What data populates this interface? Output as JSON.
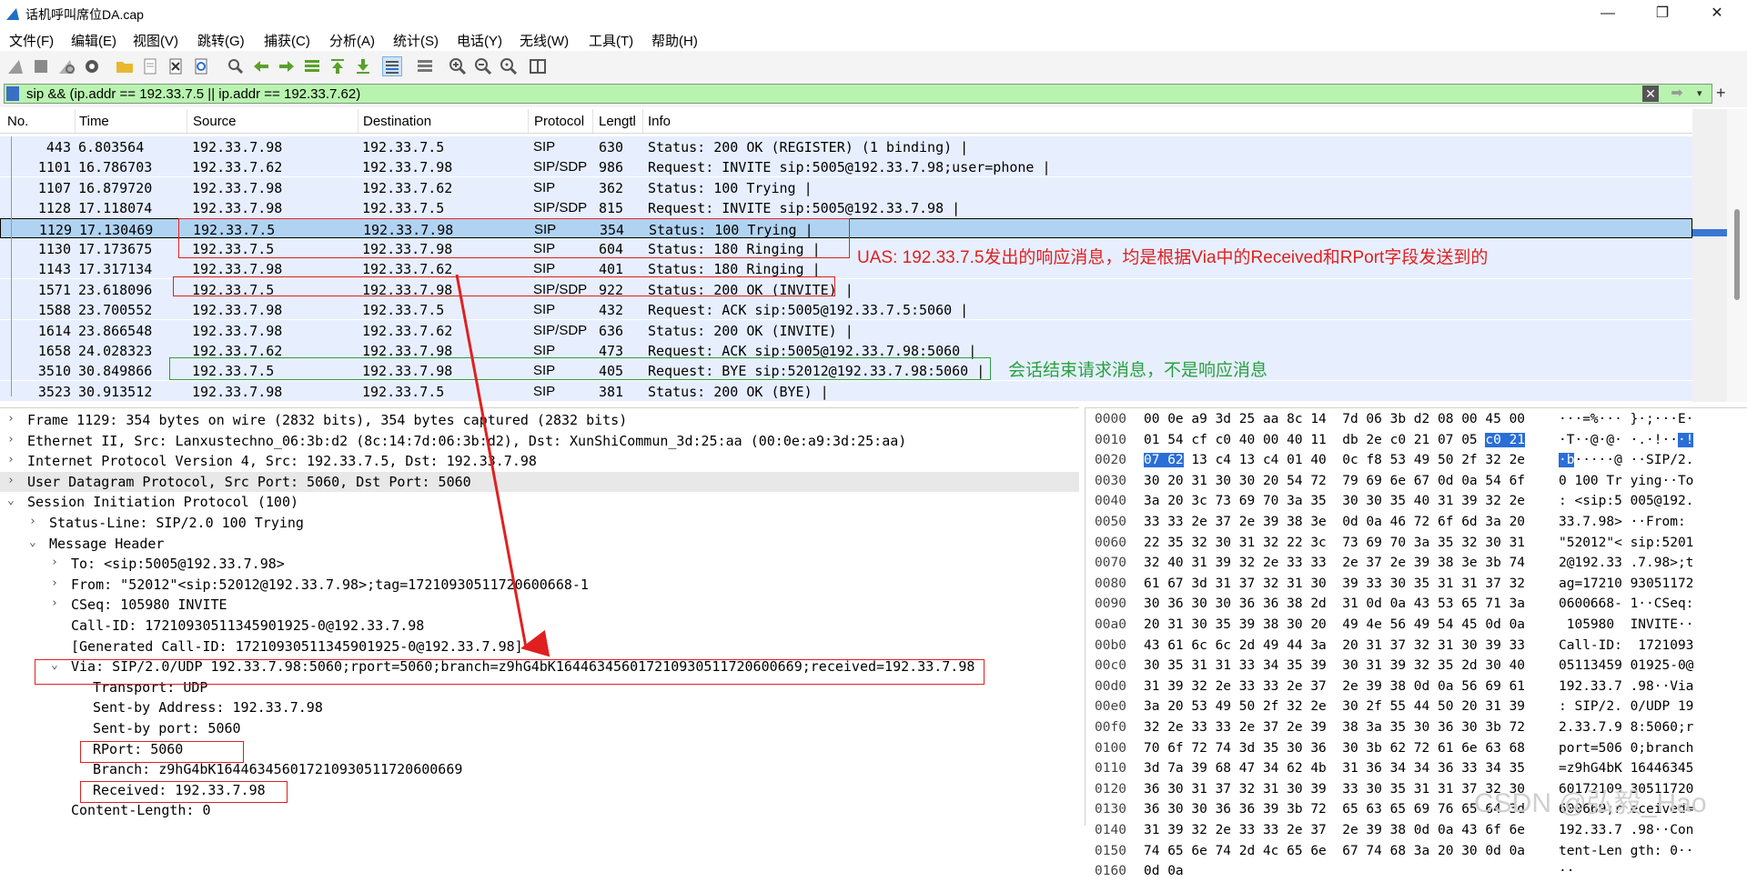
{
  "window": {
    "title": "话机呼叫席位DA.cap",
    "minimize": "—",
    "maximize": "❐",
    "close": "✕"
  },
  "menu": [
    "文件(F)",
    "编辑(E)",
    "视图(V)",
    "跳转(G)",
    "捕获(C)",
    "分析(A)",
    "统计(S)",
    "电话(Y)",
    "无线(W)",
    "工具(T)",
    "帮助(H)"
  ],
  "toolbar": {
    "icons": [
      "shark-fin-start-icon",
      "stop-icon",
      "restart-icon",
      "options-gear-icon",
      "open-folder-icon",
      "file-icon",
      "close-file-icon",
      "reload-icon",
      "find-icon",
      "back-icon",
      "forward-icon",
      "goto-packet-icon",
      "first-packet-icon",
      "last-packet-icon",
      "autoscroll-icon",
      "colorize-icon",
      "zoom-in-icon",
      "zoom-out-icon",
      "zoom-normal-icon",
      "resize-columns-icon"
    ]
  },
  "filter": {
    "text": "sip &&  (ip.addr == 192.33.7.5 || ip.addr == 192.33.7.62)",
    "clear": "✕",
    "apply": "➡",
    "dropdown": "▾",
    "add": "+"
  },
  "packet_list": {
    "columns": [
      "No.",
      "Time",
      "Source",
      "Destination",
      "Protocol",
      "Lengtl",
      "Info"
    ],
    "rows": [
      {
        "no": "443",
        "time": "6.803564",
        "src": "192.33.7.98",
        "dst": "192.33.7.5",
        "proto": "SIP",
        "len": "630",
        "info": "Status: 200 OK (REGISTER)  (1 binding) |"
      },
      {
        "no": "1101",
        "time": "16.786703",
        "src": "192.33.7.62",
        "dst": "192.33.7.98",
        "proto": "SIP/SDP",
        "len": "986",
        "info": "Request: INVITE sip:5005@192.33.7.98;user=phone |"
      },
      {
        "no": "1107",
        "time": "16.879720",
        "src": "192.33.7.98",
        "dst": "192.33.7.62",
        "proto": "SIP",
        "len": "362",
        "info": "Status: 100 Trying |"
      },
      {
        "no": "1128",
        "time": "17.118074",
        "src": "192.33.7.98",
        "dst": "192.33.7.5",
        "proto": "SIP/SDP",
        "len": "815",
        "info": "Request: INVITE sip:5005@192.33.7.98 |"
      },
      {
        "no": "1129",
        "time": "17.130469",
        "src": "192.33.7.5",
        "dst": "192.33.7.98",
        "proto": "SIP",
        "len": "354",
        "info": "Status: 100 Trying |"
      },
      {
        "no": "1130",
        "time": "17.173675",
        "src": "192.33.7.5",
        "dst": "192.33.7.98",
        "proto": "SIP",
        "len": "604",
        "info": "Status: 180 Ringing |"
      },
      {
        "no": "1143",
        "time": "17.317134",
        "src": "192.33.7.98",
        "dst": "192.33.7.62",
        "proto": "SIP",
        "len": "401",
        "info": "Status: 180 Ringing |"
      },
      {
        "no": "1571",
        "time": "23.618096",
        "src": "192.33.7.5",
        "dst": "192.33.7.98",
        "proto": "SIP/SDP",
        "len": "922",
        "info": "Status: 200 OK (INVITE) |"
      },
      {
        "no": "1588",
        "time": "23.700552",
        "src": "192.33.7.98",
        "dst": "192.33.7.5",
        "proto": "SIP",
        "len": "432",
        "info": "Request: ACK sip:5005@192.33.7.5:5060 |"
      },
      {
        "no": "1614",
        "time": "23.866548",
        "src": "192.33.7.98",
        "dst": "192.33.7.62",
        "proto": "SIP/SDP",
        "len": "636",
        "info": "Status: 200 OK (INVITE) |"
      },
      {
        "no": "1658",
        "time": "24.028323",
        "src": "192.33.7.62",
        "dst": "192.33.7.98",
        "proto": "SIP",
        "len": "473",
        "info": "Request: ACK sip:5005@192.33.7.98:5060 |"
      },
      {
        "no": "3510",
        "time": "30.849866",
        "src": "192.33.7.5",
        "dst": "192.33.7.98",
        "proto": "SIP",
        "len": "405",
        "info": "Request: BYE sip:52012@192.33.7.98:5060 |"
      },
      {
        "no": "3523",
        "time": "30.913512",
        "src": "192.33.7.98",
        "dst": "192.33.7.5",
        "proto": "SIP",
        "len": "381",
        "info": "Status: 200 OK (BYE) |"
      }
    ],
    "selected_no": "1129"
  },
  "details": [
    {
      "text": "Frame 1129: 354 bytes on wire (2832 bits), 354 bytes captured (2832 bits)",
      "arrow": "›",
      "indent": 0
    },
    {
      "text": "Ethernet II, Src: Lanxustechno_06:3b:d2 (8c:14:7d:06:3b:d2), Dst: XunShiCommun_3d:25:aa (00:0e:a9:3d:25:aa)",
      "arrow": "›",
      "indent": 0
    },
    {
      "text": "Internet Protocol Version 4, Src: 192.33.7.5, Dst: 192.33.7.98",
      "arrow": "›",
      "indent": 0
    },
    {
      "text": "User Datagram Protocol, Src Port: 5060, Dst Port: 5060",
      "arrow": "›",
      "indent": 0,
      "shade": true
    },
    {
      "text": "Session Initiation Protocol (100)",
      "arrow": "⌄",
      "indent": 0
    },
    {
      "text": "Status-Line: SIP/2.0 100 Trying",
      "arrow": "›",
      "indent": 1
    },
    {
      "text": "Message Header",
      "arrow": "⌄",
      "indent": 1
    },
    {
      "text": "To: <sip:5005@192.33.7.98>",
      "arrow": "›",
      "indent": 2
    },
    {
      "text": "From: \"52012\"<sip:52012@192.33.7.98>;tag=17210930511720600668-1",
      "arrow": "›",
      "indent": 2
    },
    {
      "text": "CSeq: 105980 INVITE",
      "arrow": "›",
      "indent": 2
    },
    {
      "text": "Call-ID: 17210930511345901925-0@192.33.7.98",
      "arrow": "",
      "indent": 2
    },
    {
      "text": "[Generated Call-ID: 17210930511345901925-0@192.33.7.98]",
      "arrow": "",
      "indent": 2
    },
    {
      "text": "Via: SIP/2.0/UDP 192.33.7.98:5060;rport=5060;branch=z9hG4bK16446345601721093051172060066​9;received=192.33.7.98",
      "arrow": "⌄",
      "indent": 2
    },
    {
      "text": "Transport: UDP",
      "arrow": "",
      "indent": 3
    },
    {
      "text": "Sent-by Address: 192.33.7.98",
      "arrow": "",
      "indent": 3
    },
    {
      "text": "Sent-by port: 5060",
      "arrow": "",
      "indent": 3
    },
    {
      "text": "RPort: 5060",
      "arrow": "",
      "indent": 3
    },
    {
      "text": "Branch: z9hG4bK16446345601721093051172060066​9",
      "arrow": "",
      "indent": 3
    },
    {
      "text": "Received: 192.33.7.98",
      "arrow": "",
      "indent": 3
    },
    {
      "text": "Content-Length: 0",
      "arrow": "",
      "indent": 2
    }
  ],
  "bytes": [
    {
      "off": "0000",
      "hex": "00 0e a9 3d 25 aa 8c 14  7d 06 3b d2 08 00 45 00",
      "asc": "···=%··· }·;···E·"
    },
    {
      "off": "0010",
      "hex": "01 54 cf c0 40 00 40 11  db 2e c0 21 07 05 c0 21",
      "asc": "·T··@·@· ·.·!···!"
    },
    {
      "off": "0020",
      "hex": "07 62 13 c4 13 c4 01 40  0c f8 53 49 50 2f 32 2e",
      "asc": "·b·····@ ··SIP/2."
    },
    {
      "off": "0030",
      "hex": "30 20 31 30 30 20 54 72  79 69 6e 67 0d 0a 54 6f",
      "asc": "0 100 Tr ying··To"
    },
    {
      "off": "0040",
      "hex": "3a 20 3c 73 69 70 3a 35  30 30 35 40 31 39 32 2e",
      "asc": ": <sip:5 005@192."
    },
    {
      "off": "0050",
      "hex": "33 33 2e 37 2e 39 38 3e  0d 0a 46 72 6f 6d 3a 20",
      "asc": "33.7.98> ··From: "
    },
    {
      "off": "0060",
      "hex": "22 35 32 30 31 32 22 3c  73 69 70 3a 35 32 30 31",
      "asc": "\"52012\"< sip:5201"
    },
    {
      "off": "0070",
      "hex": "32 40 31 39 32 2e 33 33  2e 37 2e 39 38 3e 3b 74",
      "asc": "2@192.33 .7.98>;t"
    },
    {
      "off": "0080",
      "hex": "61 67 3d 31 37 32 31 30  39 33 30 35 31 31 37 32",
      "asc": "ag=17210 93051172"
    },
    {
      "off": "0090",
      "hex": "30 36 30 30 36 36 38 2d  31 0d 0a 43 53 65 71 3a",
      "asc": "0600668- 1··CSeq:"
    },
    {
      "off": "00a0",
      "hex": "20 31 30 35 39 38 30 20  49 4e 56 49 54 45 0d 0a",
      "asc": " 105980  INVITE··"
    },
    {
      "off": "00b0",
      "hex": "43 61 6c 6c 2d 49 44 3a  20 31 37 32 31 30 39 33",
      "asc": "Call-ID:  1721093"
    },
    {
      "off": "00c0",
      "hex": "30 35 31 31 33 34 35 39  30 31 39 32 35 2d 30 40",
      "asc": "05113459 01925-0@"
    },
    {
      "off": "00d0",
      "hex": "31 39 32 2e 33 33 2e 37  2e 39 38 0d 0a 56 69 61",
      "asc": "192.33.7 .98··Via"
    },
    {
      "off": "00e0",
      "hex": "3a 20 53 49 50 2f 32 2e  30 2f 55 44 50 20 31 39",
      "asc": ": SIP/2. 0/UDP 19"
    },
    {
      "off": "00f0",
      "hex": "32 2e 33 33 2e 37 2e 39  38 3a 35 30 36 30 3b 72",
      "asc": "2.33.7.9 8:5060;r"
    },
    {
      "off": "0100",
      "hex": "70 6f 72 74 3d 35 30 36  30 3b 62 72 61 6e 63 68",
      "asc": "port=506 0;branch"
    },
    {
      "off": "0110",
      "hex": "3d 7a 39 68 47 34 62 4b  31 36 34 34 36 33 34 35",
      "asc": "=z9hG4bK 16446345"
    },
    {
      "off": "0120",
      "hex": "36 30 31 37 32 31 30 39  33 30 35 31 31 37 32 30",
      "asc": "60172109 30511720"
    },
    {
      "off": "0130",
      "hex": "36 30 30 36 36 39 3b 72  65 63 65 69 76 65 64 3d",
      "asc": "600669;r eceived="
    },
    {
      "off": "0140",
      "hex": "31 39 32 2e 33 33 2e 37  2e 39 38 0d 0a 43 6f 6e",
      "asc": "192.33.7 .98··Con"
    },
    {
      "off": "0150",
      "hex": "74 65 6e 74 2d 4c 65 6e  67 74 68 3a 20 30 0d 0a",
      "asc": "tent-Len gth: 0··"
    },
    {
      "off": "0160",
      "hex": "0d 0a",
      "asc": "··"
    }
  ],
  "annotations": {
    "uas_note": "UAS: 192.33.7.5发出的响应消息，均是根据Via中的Received和RPort字段发送到的",
    "bye_note": "会话结束请求消息，不是响应消息"
  },
  "watermark": "CSDN @弘毅_Hao",
  "colors": {
    "filter_bg": "#b9f3b0",
    "row_bg": "#e7efff",
    "selected_bg": "#b1d3f2",
    "annotation_red": "#e02020",
    "annotation_green": "#2aa040",
    "byte_highlight": "#2a6ed8"
  }
}
